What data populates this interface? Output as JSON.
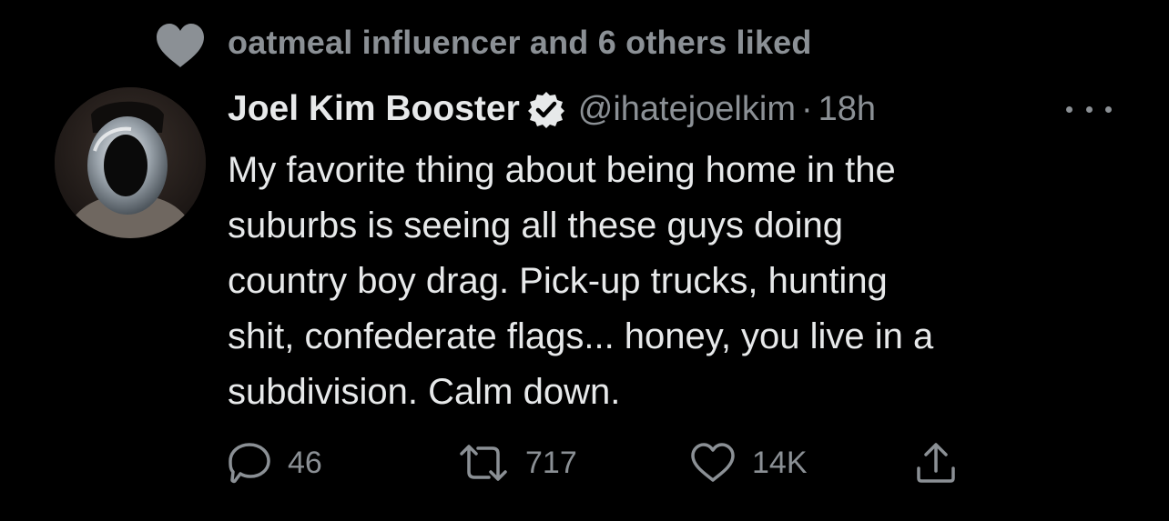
{
  "social_context": {
    "text": "oatmeal influencer and 6 others liked",
    "icon": "heart-filled-icon"
  },
  "tweet": {
    "display_name": "Joel Kim Booster",
    "verified": true,
    "handle": "@ihatejoelkim",
    "separator": "·",
    "time": "18h",
    "text": "My favorite thing about being home in the\nsuburbs is seeing all these guys doing\ncountry boy drag. Pick-up trucks, hunting\nshit, confederate flags... honey, you live in a\nsubdivision. Calm down."
  },
  "actions": {
    "reply_count": "46",
    "retweet_count": "717",
    "like_count": "14K"
  },
  "colors": {
    "background": "#000000",
    "primary_text": "#e7e9ea",
    "secondary_text": "#8b9095"
  }
}
